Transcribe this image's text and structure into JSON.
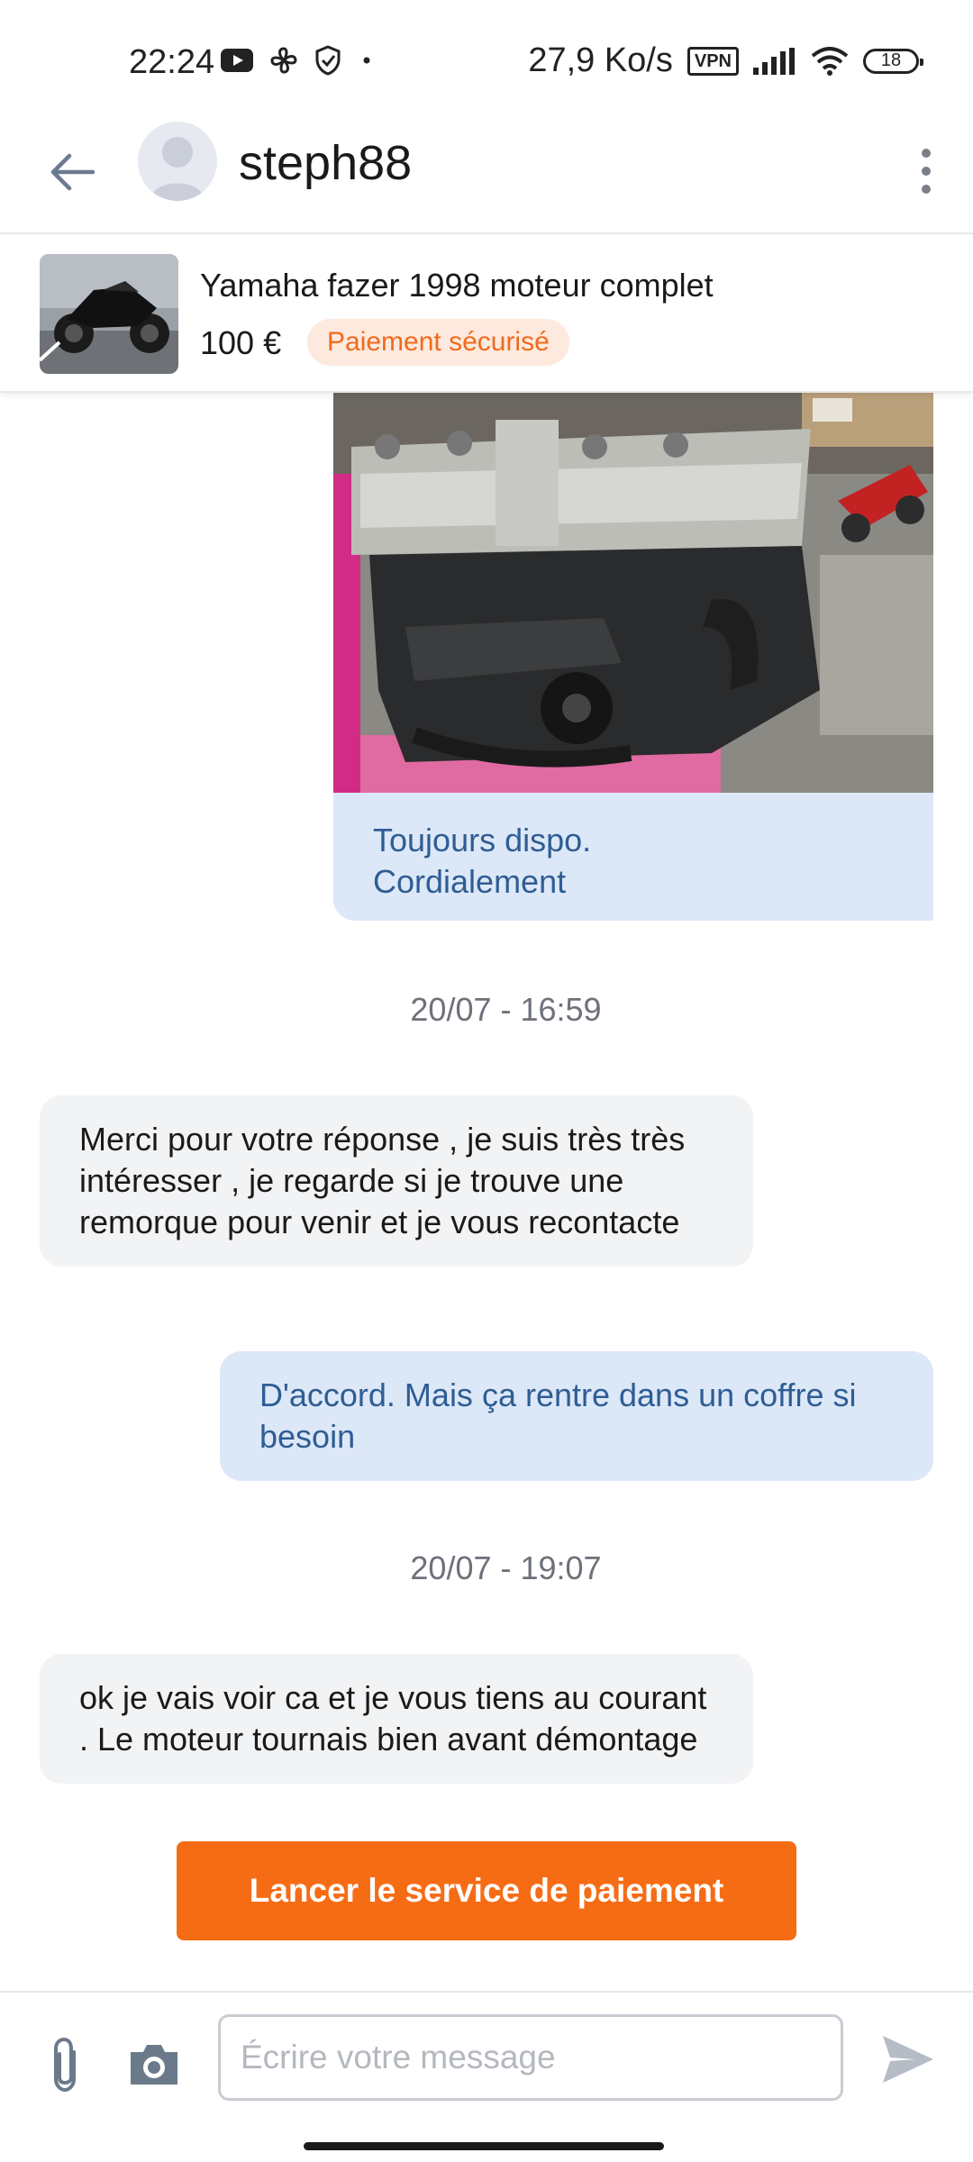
{
  "status_bar": {
    "time": "22:24",
    "network_speed": "27,9 Ko/s",
    "vpn_label": "VPN",
    "battery": "18"
  },
  "header": {
    "username": "steph88"
  },
  "listing": {
    "title": "Yamaha fazer 1998 moteur complet",
    "price": "100 €",
    "badge": "Paiement sécurisé"
  },
  "messages": [
    {
      "direction": "outgoing",
      "type": "image",
      "caption": "Toujours dispo.\nCordialement"
    },
    {
      "type": "timestamp",
      "text": "20/07 - 16:59"
    },
    {
      "direction": "incoming",
      "text": "Merci pour votre réponse , je suis très très intéresser , je regarde si je trouve une remorque pour venir et je vous recontacte"
    },
    {
      "direction": "outgoing",
      "text": "D'accord. Mais ça rentre dans un coffre si besoin"
    },
    {
      "type": "timestamp",
      "text": "20/07 - 19:07"
    },
    {
      "direction": "incoming",
      "text": "ok je vais voir ca et je vous tiens au courant . Le moteur tournais bien avant démontage"
    }
  ],
  "actions": {
    "pay_button": "Lancer le service de paiement"
  },
  "composer": {
    "placeholder": "Écrire votre message",
    "value": ""
  },
  "colors": {
    "accent": "#f66c15",
    "outgoing_bubble": "#dce8f7",
    "outgoing_text": "#2f5d94",
    "incoming_bubble": "#f2f3f5",
    "badge_bg": "#fde9de"
  }
}
